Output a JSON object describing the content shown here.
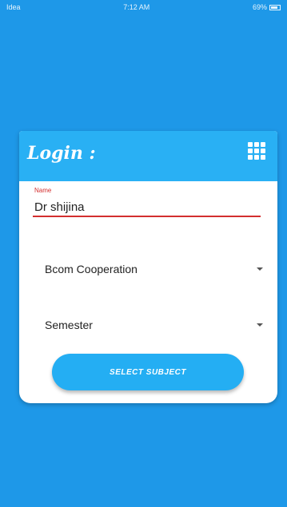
{
  "status_bar": {
    "carrier": "Idea",
    "time": "7:12 AM",
    "battery": "69%"
  },
  "login_card": {
    "title": "Login :",
    "menu_icon": "grid-icon",
    "name_label": "Name",
    "name_value": "Dr shijina",
    "course_select": "Bcom Cooperation",
    "semester_select": "Semester",
    "submit_label": "SELECT SUBJECT"
  },
  "colors": {
    "background": "#1e98e8",
    "header": "#29b0f4",
    "accent_error": "#d32f2f",
    "button": "#24aef3"
  }
}
